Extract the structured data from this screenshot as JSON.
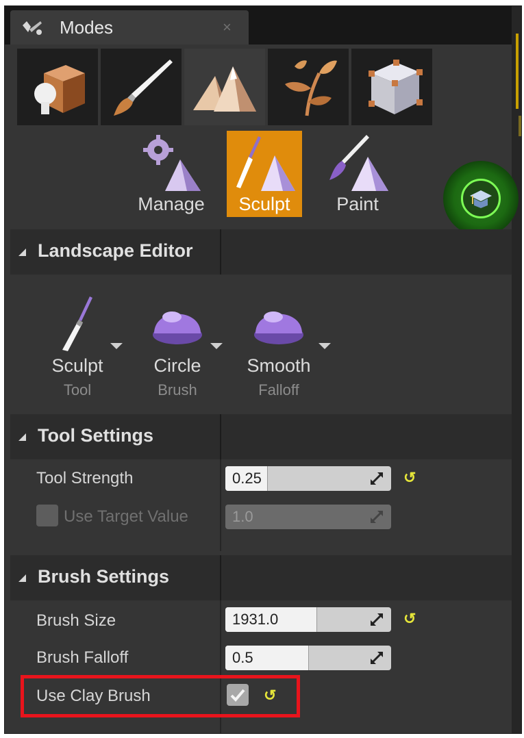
{
  "tab": {
    "title": "Modes",
    "close_glyph": "×",
    "icon": "modes-wand-icon"
  },
  "mode_buttons": [
    {
      "name": "place-mode",
      "icon": "place-cube-icon",
      "active": false
    },
    {
      "name": "paint-mode",
      "icon": "paint-brush-icon",
      "active": false
    },
    {
      "name": "landscape-mode",
      "icon": "landscape-mountains-icon",
      "active": true
    },
    {
      "name": "foliage-mode",
      "icon": "foliage-leaves-icon",
      "active": false
    },
    {
      "name": "geometry-mode",
      "icon": "geometry-cube-icon",
      "active": false
    }
  ],
  "landscape_tabs": [
    {
      "label": "Manage",
      "active": false
    },
    {
      "label": "Sculpt",
      "active": true
    },
    {
      "label": "Paint",
      "active": false
    }
  ],
  "tutorial_icon": "tutorial-graduation-cap-icon",
  "landscape_editor": {
    "header": "Landscape Editor",
    "tool": {
      "label": "Sculpt",
      "sub": "Tool"
    },
    "brush": {
      "label": "Circle",
      "sub": "Brush"
    },
    "falloff": {
      "label": "Smooth",
      "sub": "Falloff"
    }
  },
  "tool_settings": {
    "header": "Tool Settings",
    "tool_strength": {
      "label": "Tool Strength",
      "value": "0.25",
      "fill_fraction": 0.25
    },
    "use_target_value": {
      "label": "Use Target Value",
      "value": "1.0",
      "enabled": false,
      "checked": false
    }
  },
  "brush_settings": {
    "header": "Brush Settings",
    "brush_size": {
      "label": "Brush Size",
      "value": "1931.0",
      "fill_fraction": 0.55
    },
    "brush_falloff": {
      "label": "Brush Falloff",
      "value": "0.5",
      "fill_fraction": 0.5
    },
    "use_clay_brush": {
      "label": "Use Clay Brush",
      "checked": true
    }
  },
  "reset_glyph": "↺",
  "colors": {
    "panel_bg": "#353535",
    "accent_orange": "#e08c0c",
    "highlight_red": "#e8141c",
    "reset_yellow": "#e6e63a",
    "tutorial_green": "#7dff55"
  }
}
